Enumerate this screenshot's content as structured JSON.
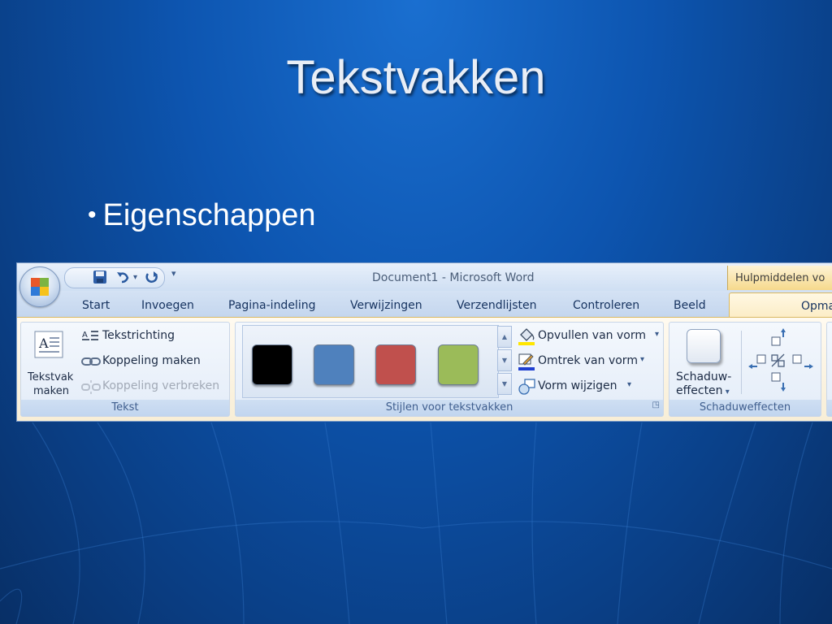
{
  "slide": {
    "title": "Tekstvakken",
    "bullet": "Eigenschappen"
  },
  "window": {
    "title": "Document1 - Microsoft Word",
    "contextual_header": "Hulpmiddelen vo",
    "qat_customize": "▾"
  },
  "tabs": [
    "Start",
    "Invoegen",
    "Pagina-indeling",
    "Verwijzingen",
    "Verzendlijsten",
    "Controleren",
    "Beeld"
  ],
  "active_tab": "Opma",
  "groups": {
    "tekst": {
      "label": "Tekst",
      "big_button_line1": "Tekstvak",
      "big_button_line2": "maken",
      "items": [
        "Tekstrichting",
        "Koppeling maken",
        "Koppeling verbreken"
      ]
    },
    "stijlen": {
      "label": "Stijlen voor tekstvakken",
      "swatch_colors": [
        "#000000",
        "#4f81bd",
        "#c0504d",
        "#9bbb59"
      ],
      "items": [
        "Opvullen van vorm",
        "Omtrek van vorm",
        "Vorm wijzigen"
      ]
    },
    "schaduw": {
      "label": "Schaduweffecten",
      "button_line1": "Schaduw-",
      "button_line2": "effecten"
    }
  }
}
